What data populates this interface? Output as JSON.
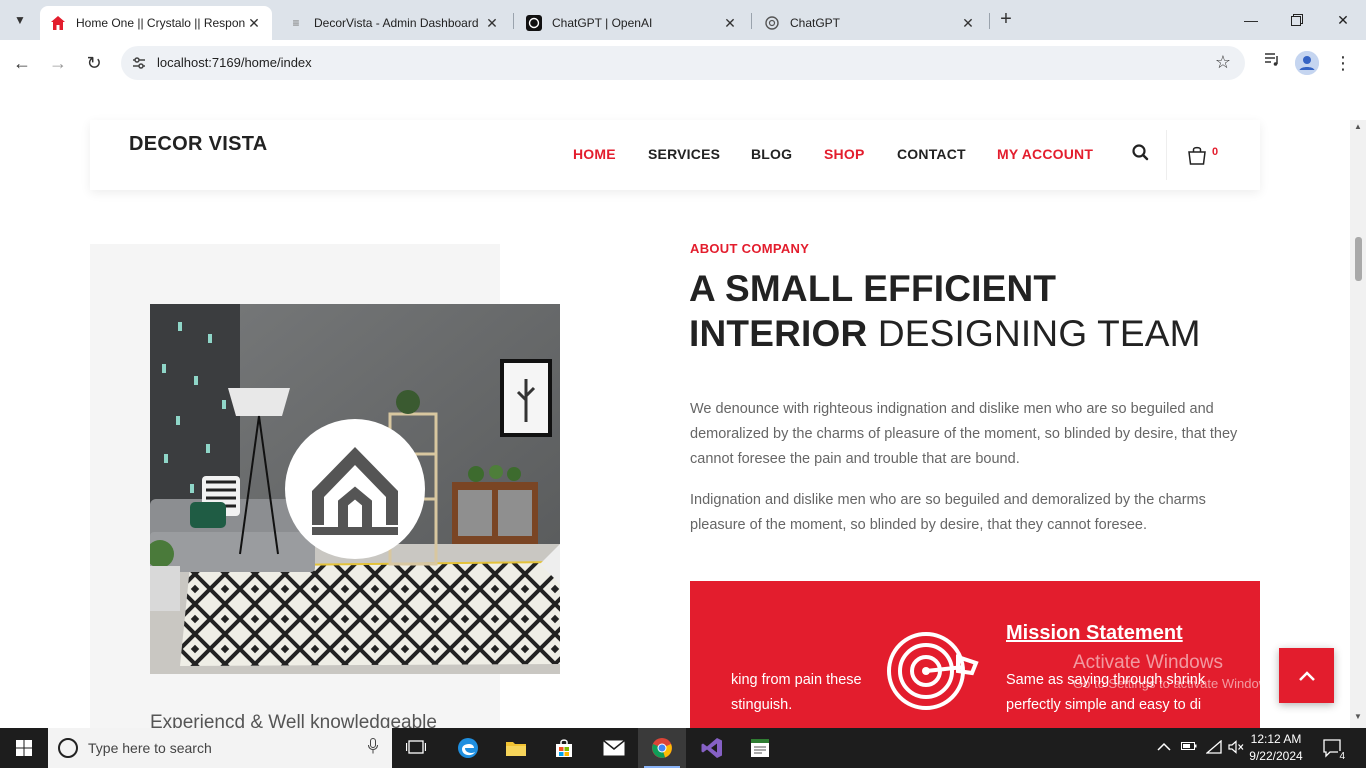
{
  "browser": {
    "tabs": [
      {
        "title": "Home One || Crystalo || Respon",
        "active": true
      },
      {
        "title": "DecorVista - Admin Dashboard",
        "active": false
      },
      {
        "title": "ChatGPT | OpenAI",
        "active": false
      },
      {
        "title": "ChatGPT",
        "active": false
      }
    ],
    "url": "localhost:7169/home/index"
  },
  "site": {
    "logo": "DECOR VISTA",
    "nav": [
      {
        "label": "HOME",
        "color": "#e31d2d"
      },
      {
        "label": "SERVICES",
        "color": "#222222"
      },
      {
        "label": "BLOG",
        "color": "#222222"
      },
      {
        "label": "SHOP",
        "color": "#e31d2d"
      },
      {
        "label": "CONTACT",
        "color": "#222222"
      },
      {
        "label": "MY ACCOUNT",
        "color": "#e31d2d"
      }
    ],
    "cart_count": "0",
    "accent": "#e31d2d"
  },
  "about": {
    "eyebrow": "ABOUT COMPANY",
    "headline_line1": "A SMALL EFFICIENT",
    "headline_line2_bold": "INTERIOR",
    "headline_line2_thin": "DESIGNING TEAM",
    "para1": "We denounce with righteous indignation and dislike men who are so beguiled and demoralized by the charms of pleasure of the moment, so blinded by desire, that they cannot foresee the pain and trouble that are bound.",
    "para2": "Indignation and dislike men who are so beguiled and demoralized by the charms pleasure of the moment, so blinded by desire, that they cannot foresee.",
    "experience_text": "Experiencd & Well knowledgeable"
  },
  "mission": {
    "left_line1": "king from pain these",
    "left_line2": "stinguish.",
    "title": "Mission Statement",
    "line1": "Same as saying through shrink",
    "line2": "perfectly simple and easy to di"
  },
  "watermark": {
    "line1": "Activate Windows",
    "line2": "Go to Settings to activate Windows."
  },
  "taskbar": {
    "search_placeholder": "Type here to search",
    "time": "12:12 AM",
    "date": "9/22/2024",
    "notifications": "4"
  }
}
